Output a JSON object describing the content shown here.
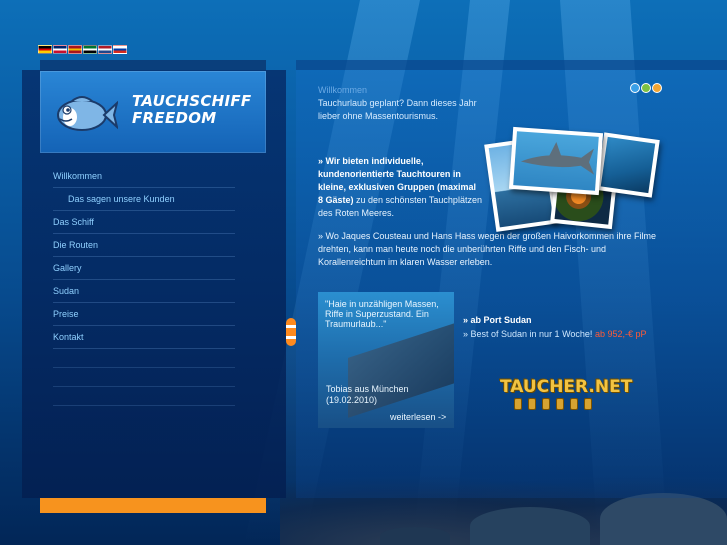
{
  "header": {
    "languages": [
      {
        "name": "german-flag",
        "colors": [
          "#000000",
          "#dd0000",
          "#ffce00"
        ]
      },
      {
        "name": "english-flag",
        "colors": [
          "#012169",
          "#ffffff",
          "#c8102e"
        ]
      },
      {
        "name": "spanish-flag",
        "colors": [
          "#aa151b",
          "#f1bf00",
          "#aa151b"
        ]
      },
      {
        "name": "arabic-flag",
        "colors": [
          "#00732f",
          "#ffffff",
          "#000000"
        ]
      },
      {
        "name": "dutch-flag",
        "colors": [
          "#ae1c28",
          "#ffffff",
          "#21468b"
        ]
      },
      {
        "name": "russian-flag",
        "colors": [
          "#ffffff",
          "#0039a6",
          "#d52b1e"
        ]
      }
    ]
  },
  "logo": {
    "line1": "TAUCHSCHIFF",
    "line2": "FREEDOM"
  },
  "nav": {
    "items": [
      {
        "label": "Willkommen"
      },
      {
        "label": "Das sagen unsere Kunden"
      },
      {
        "label": "Das Schiff"
      },
      {
        "label": "Die Routen"
      },
      {
        "label": "Gallery"
      },
      {
        "label": "Sudan"
      },
      {
        "label": "Preise"
      },
      {
        "label": "Kontakt"
      }
    ]
  },
  "main": {
    "welcome": "Willkommen",
    "intro": "Tauchurlaub geplant? Dann dieses Jahr lieber ohne Massentourismus.",
    "bullet1_bold": "» Wir bieten individuelle, kundenorientierte Tauchtouren in kleine, exklusiven Gruppen (maximal 8 Gäste)",
    "bullet1_rest": " zu den schönsten Tauchplätzen des Roten Meeres.",
    "bullet2": "» Wo Jaques Cousteau und Hans Hass wegen der großen Haivorkommen ihre Filme drehten, kann man heute noch die unberührten Riffe und den Fisch- und Korallenreichtum im klaren Wasser erleben."
  },
  "quote": {
    "text": "\"Haie in unzähligen Massen, Riffe in Superzustand. Ein Traumurlaub...\"",
    "author_line1": "Tobias aus München",
    "author_line2": "(19.02.2010)",
    "more": "weiterlesen ->"
  },
  "offer": {
    "title": "» ab Port Sudan",
    "line_label": "» Best of Sudan in nur 1 Woche!",
    "price": "ab 952,-€ pP"
  },
  "partner": {
    "name": "TAUCHER.NET"
  },
  "colors": {
    "accent_orange": "#f7931e",
    "nav_link": "#8fd0ff",
    "price_red": "#ff5a36",
    "offer_yellow": "#ffd000"
  }
}
